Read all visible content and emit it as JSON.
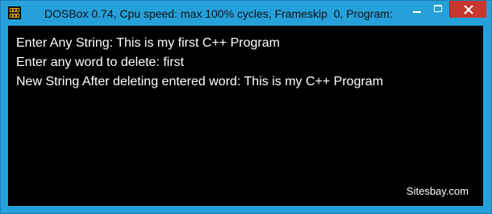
{
  "window": {
    "title": "DOSBox 0.74, Cpu speed: max 100% cycles, Frameskip  0, Program:",
    "app_icon": "dosbox-icon",
    "controls": [
      "minimize-icon",
      "maximize-icon",
      "close-icon"
    ],
    "accent_color": "#26a0da",
    "close_color": "#c7372f"
  },
  "console": {
    "background": "#000000",
    "lines": [
      "Enter Any String: This is my first C++ Program",
      "Enter any word to delete: first",
      "New String After deleting entered word: This is my C++ Program"
    ],
    "watermark": "Sitesbay.com"
  }
}
